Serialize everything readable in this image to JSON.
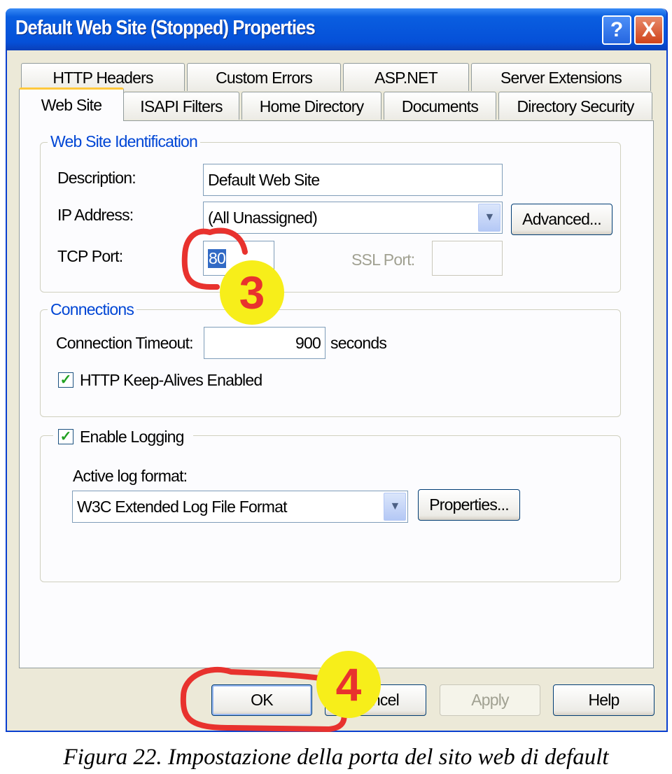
{
  "window": {
    "title": "Default Web Site (Stopped) Properties",
    "help_button": "?",
    "close_button": "X"
  },
  "tabs": {
    "row1": [
      "HTTP Headers",
      "Custom Errors",
      "ASP.NET",
      "Server Extensions"
    ],
    "row2": [
      "Web Site",
      "ISAPI Filters",
      "Home Directory",
      "Documents",
      "Directory Security"
    ],
    "active": "Web Site"
  },
  "identification": {
    "legend": "Web Site Identification",
    "description_label": "Description:",
    "description_value": "Default Web Site",
    "ip_label": "IP Address:",
    "ip_value": "(All Unassigned)",
    "advanced_button": "Advanced...",
    "tcp_label": "TCP Port:",
    "tcp_value": "80",
    "ssl_label": "SSL Port:",
    "ssl_value": ""
  },
  "connections": {
    "legend": "Connections",
    "timeout_label": "Connection Timeout:",
    "timeout_value": "900",
    "timeout_unit": "seconds",
    "keepalive_label": "HTTP Keep-Alives Enabled",
    "keepalive_checked": true
  },
  "logging": {
    "enable_label": "Enable Logging",
    "enable_checked": true,
    "format_label": "Active log format:",
    "format_value": "W3C Extended Log File Format",
    "properties_button": "Properties..."
  },
  "buttons": {
    "ok": "OK",
    "cancel": "Cancel",
    "apply": "Apply",
    "help": "Help"
  },
  "annotations": {
    "step3": "3",
    "step4": "4",
    "marker_color": "#f7ee1a",
    "circle_color": "#e8322e"
  },
  "caption": "Figura 22. Impostazione della porta del sito web di default"
}
